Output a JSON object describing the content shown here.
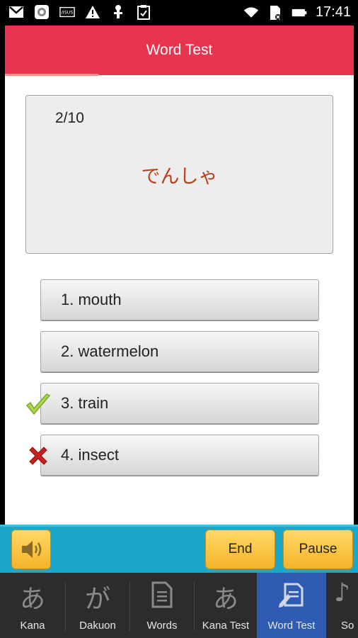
{
  "status_bar": {
    "time": "17:41",
    "icons_left": [
      "gmail-icon",
      "photo-icon",
      "asus-icon",
      "warning-icon",
      "android-icon",
      "clipboard-icon"
    ],
    "icons_right": [
      "wifi-icon",
      "no-sim-icon",
      "battery-icon"
    ]
  },
  "header": {
    "title": "Word Test"
  },
  "question": {
    "progress": "2/10",
    "word": "でんしゃ"
  },
  "options": [
    {
      "label": "1. mouth",
      "mark": ""
    },
    {
      "label": "2. watermelon",
      "mark": ""
    },
    {
      "label": "3. train",
      "mark": "correct"
    },
    {
      "label": "4. insect",
      "mark": "wrong"
    }
  ],
  "controls": {
    "speaker_icon": "speaker-icon",
    "end_label": "End",
    "pause_label": "Pause"
  },
  "nav": {
    "items": [
      {
        "glyph": "あ",
        "label": "Kana"
      },
      {
        "glyph": "が",
        "label": "Dakuon"
      },
      {
        "glyph": "",
        "label": "Words",
        "icon": "document-icon"
      },
      {
        "glyph": "あ",
        "label": "Kana Test"
      },
      {
        "glyph": "",
        "label": "Word Test",
        "icon": "test-pencil-icon",
        "active": true
      },
      {
        "glyph": "♪",
        "label": "So"
      }
    ]
  },
  "colors": {
    "title_bar": "#e8344f",
    "control_bar": "#1ba7c9",
    "button": "#f7c236",
    "nav_active": "#2f5bb3",
    "answer_text": "#b4421d"
  }
}
